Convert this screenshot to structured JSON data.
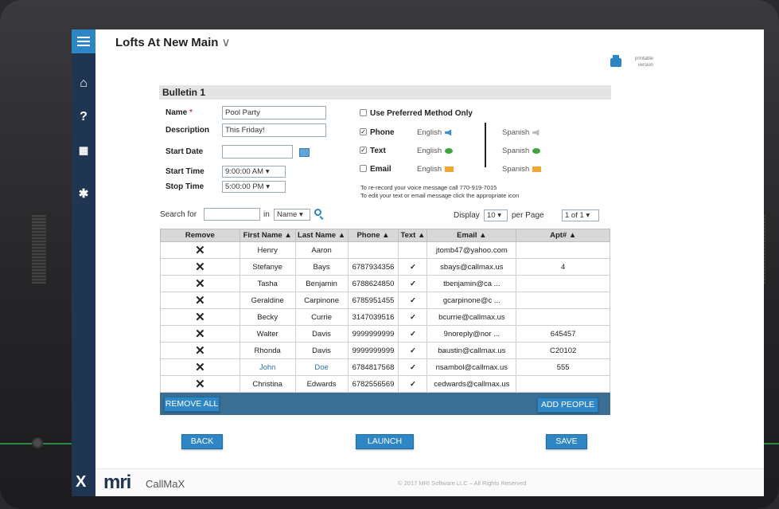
{
  "app": {
    "title": "Lofts At New Main",
    "chevron": "∨"
  },
  "printable": {
    "label": "printable version"
  },
  "form": {
    "section_title": "Bulletin 1",
    "name_label": "Name",
    "required_mark": "*",
    "name_value": "Pool Party",
    "description_label": "Description",
    "description_value": "This Friday!",
    "start_date_label": "Start Date",
    "start_date_value": "",
    "start_time_label": "Start Time",
    "start_time_value": "9:00:00 AM",
    "stop_time_label": "Stop Time",
    "stop_time_value": "5:00:00 PM"
  },
  "methods": {
    "preferred_label": "Use Preferred Method Only",
    "preferred_checked": false,
    "phone": {
      "label": "Phone",
      "checked": true,
      "english": "English",
      "spanish": "Spanish"
    },
    "text": {
      "label": "Text",
      "checked": true,
      "english": "English",
      "spanish": "Spanish"
    },
    "email": {
      "label": "Email",
      "checked": false,
      "english": "English",
      "spanish": "Spanish"
    },
    "note1": "To re-record your voice message call 770-919-7015",
    "note2": "To edit your text or email message click the appropriate icon"
  },
  "search": {
    "label": "Search for",
    "value": "",
    "in_label": "in",
    "field": "Name",
    "display_label": "Display",
    "per_page": "10",
    "per_page_label": "per Page",
    "page": "1 of 1"
  },
  "table": {
    "headers": [
      "Remove",
      "First Name ▲",
      "Last Name ▲",
      "Phone ▲",
      "Text ▲",
      "Email ▲",
      "Apt# ▲"
    ],
    "rows": [
      {
        "remove": "✕",
        "first": "Henry",
        "last": "Aaron",
        "phone": "",
        "text": "",
        "email": "jtomb47@yahoo.com",
        "apt": ""
      },
      {
        "remove": "✕",
        "first": "Stefanye",
        "last": "Bays",
        "phone": "6787934356",
        "text": "✓",
        "email": "sbays@callmax.us",
        "apt": "4"
      },
      {
        "remove": "✕",
        "first": "Tasha",
        "last": "Benjamin",
        "phone": "6788624850",
        "text": "✓",
        "email": "tbenjamin@ca ...",
        "apt": ""
      },
      {
        "remove": "✕",
        "first": "Geraldine",
        "last": "Carpinone",
        "phone": "6785951455",
        "text": "✓",
        "email": "gcarpinone@c ...",
        "apt": ""
      },
      {
        "remove": "✕",
        "first": "Becky",
        "last": "Currie",
        "phone": "3147039516",
        "text": "✓",
        "email": "bcurrie@callmax.us",
        "apt": ""
      },
      {
        "remove": "✕",
        "first": "Walter",
        "last": "Davis",
        "phone": "9999999999",
        "text": "✓",
        "email": "9noreply@nor ...",
        "apt": "645457"
      },
      {
        "remove": "✕",
        "first": "Rhonda",
        "last": "Davis",
        "phone": "9999999999",
        "text": "✓",
        "email": "baustin@callmax.us",
        "apt": "C20102"
      },
      {
        "remove": "✕",
        "first": "John",
        "last": "Doe",
        "phone": "6784817568",
        "text": "✓",
        "email": "nsambol@callmax.us",
        "apt": "555"
      },
      {
        "remove": "✕",
        "first": "Christina",
        "last": "Edwards",
        "phone": "6782556569",
        "text": "✓",
        "email": "cedwards@callmax.us",
        "apt": ""
      }
    ]
  },
  "buttons": {
    "remove_all": "REMOVE ALL",
    "add_people": "ADD PEOPLE",
    "back": "BACK",
    "launch": "LAUNCH",
    "save": "SAVE"
  },
  "footer": {
    "brand": "mri",
    "product": "CallMaX",
    "copyright": "© 2017 MRI Software LLC – All Rights Reserved",
    "x_logo": "X"
  },
  "colors": {
    "accent": "#2f86c4",
    "sidebar": "#1f3552",
    "check": "#2e9a3a"
  }
}
